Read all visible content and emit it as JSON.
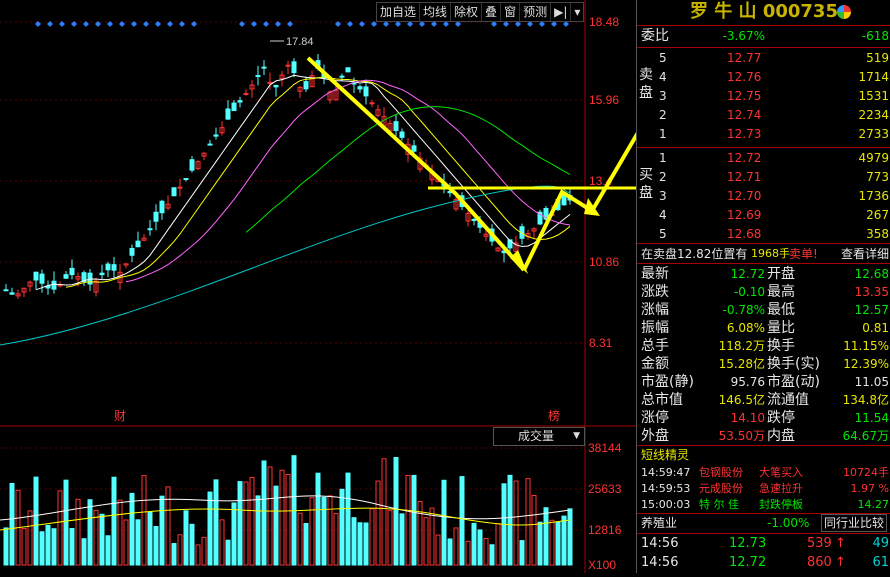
{
  "toolbar": [
    "加自选",
    "均线",
    "除权",
    "叠",
    "窗",
    "预测"
  ],
  "price_axis": [
    "18.48",
    "15.96",
    "13.4",
    "10.86",
    "8.31"
  ],
  "peak_label": "17.84",
  "marks": {
    "left": "财",
    "right": "榜"
  },
  "volume_axis": [
    "38144",
    "25633",
    "12816",
    "X100"
  ],
  "volume_select": "成交量",
  "stock": {
    "name": "罗 牛 山",
    "code": "000735"
  },
  "weibi": {
    "label": "委比",
    "pct": "-3.67%",
    "val": "-618"
  },
  "sell_label": "卖盘",
  "buy_label": "买盘",
  "sell": [
    {
      "lvl": "5",
      "price": "12.77",
      "vol": "519"
    },
    {
      "lvl": "4",
      "price": "12.76",
      "vol": "1714"
    },
    {
      "lvl": "3",
      "price": "12.75",
      "vol": "1531"
    },
    {
      "lvl": "2",
      "price": "12.74",
      "vol": "2234"
    },
    {
      "lvl": "1",
      "price": "12.73",
      "vol": "2733"
    }
  ],
  "buy": [
    {
      "lvl": "1",
      "price": "12.72",
      "vol": "4979"
    },
    {
      "lvl": "2",
      "price": "12.71",
      "vol": "773"
    },
    {
      "lvl": "3",
      "price": "12.70",
      "vol": "1736"
    },
    {
      "lvl": "4",
      "price": "12.69",
      "vol": "267"
    },
    {
      "lvl": "5",
      "price": "12.68",
      "vol": "358"
    }
  ],
  "notice": {
    "pre": "在卖盘12.82位置有",
    "qty": "1968手",
    "post": "卖单!",
    "link": "查看详细"
  },
  "stats": [
    {
      "l1": "最新",
      "v1": "12.72",
      "c1": "green",
      "l2": "开盘",
      "v2": "12.68",
      "c2": "green"
    },
    {
      "l1": "涨跌",
      "v1": "-0.10",
      "c1": "green",
      "l2": "最高",
      "v2": "13.35",
      "c2": "red"
    },
    {
      "l1": "涨幅",
      "v1": "-0.78%",
      "c1": "green",
      "l2": "最低",
      "v2": "12.57",
      "c2": "green"
    },
    {
      "l1": "振幅",
      "v1": "6.08%",
      "c1": "yellow",
      "l2": "量比",
      "v2": "0.81",
      "c2": "yellow"
    },
    {
      "l1": "总手",
      "v1": "118.2万",
      "c1": "yellow",
      "l2": "换手",
      "v2": "11.15%",
      "c2": "yellow"
    },
    {
      "l1": "金额",
      "v1": "15.28亿",
      "c1": "yellow",
      "l2": "换手(实)",
      "v2": "12.39%",
      "c2": "yellow"
    },
    {
      "l1": "市盈(静)",
      "v1": "95.76",
      "c1": "white",
      "l2": "市盈(动)",
      "v2": "11.05",
      "c2": "white"
    },
    {
      "l1": "总市值",
      "v1": "146.5亿",
      "c1": "yellow",
      "l2": "流通值",
      "v2": "134.8亿",
      "c2": "yellow"
    },
    {
      "l1": "涨停",
      "v1": "14.10",
      "c1": "red",
      "l2": "跌停",
      "v2": "11.54",
      "c2": "green"
    },
    {
      "l1": "外盘",
      "v1": "53.50万",
      "c1": "red",
      "l2": "内盘",
      "v2": "64.67万",
      "c2": "green"
    }
  ],
  "short_title": "短线精灵",
  "short_rows": [
    {
      "time": "14:59:47",
      "name": "包钢股份",
      "event": "大笔买入",
      "val": "10724手",
      "ec": "red"
    },
    {
      "time": "14:59:53",
      "name": "元成股份",
      "event": "急速拉升",
      "val": "1.97 %",
      "ec": "red"
    },
    {
      "time": "15:00:03",
      "name": "特 尔 佳",
      "event": "封跌停板",
      "val": "14.27",
      "ec": "green"
    }
  ],
  "industry": {
    "name": "养殖业",
    "pct": "-1.00%",
    "compare": "同行业比较"
  },
  "ticks": [
    {
      "time": "14:56",
      "price": "12.73",
      "vol": "539",
      "arrow": "↑",
      "n": "49"
    },
    {
      "time": "14:56",
      "price": "12.72",
      "vol": "860",
      "arrow": "↑",
      "n": "61"
    }
  ]
}
